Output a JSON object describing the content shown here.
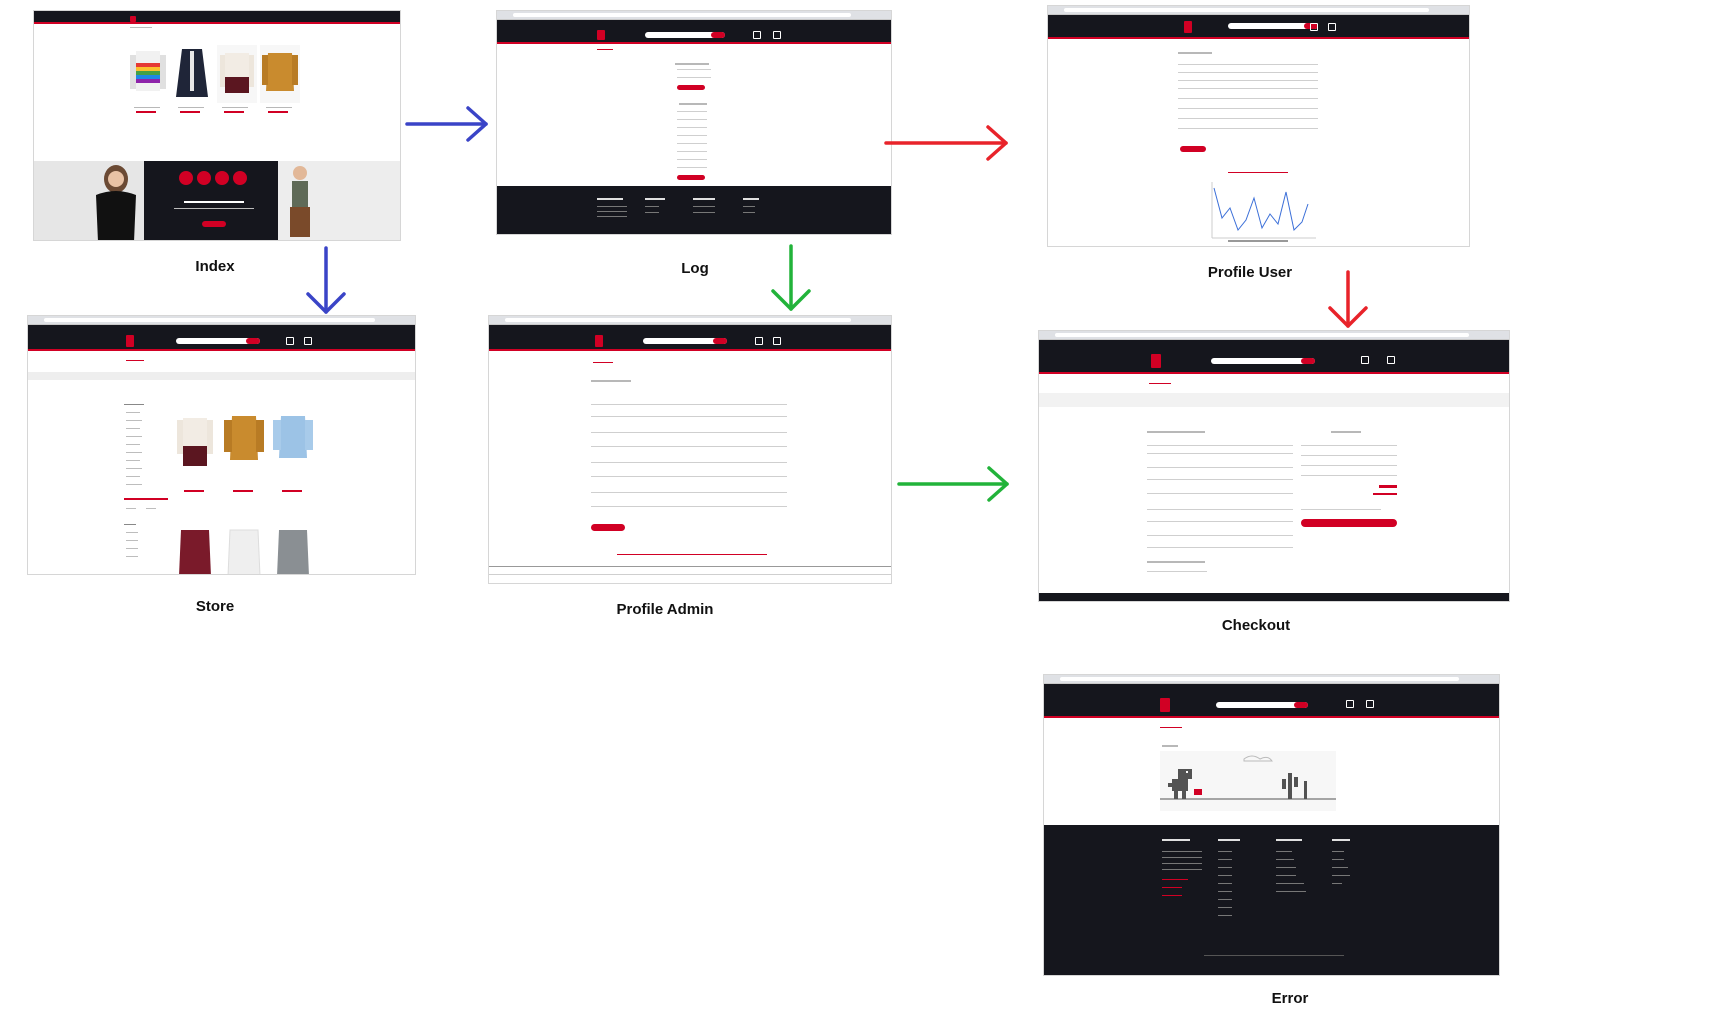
{
  "captions": {
    "index": "Index",
    "log": "Log",
    "profile_user": "Profile User",
    "store": "Store",
    "profile_admin": "Profile Admin",
    "checkout": "Checkout",
    "error": "Error"
  },
  "arrow_colors": {
    "index_to_log": "#3a44c7",
    "index_to_store": "#3a44c7",
    "log_to_profile_user": "#e8232a",
    "profile_user_to_checkout": "#e8232a",
    "log_to_profile_admin": "#22b33a",
    "profile_admin_to_checkout": "#22b33a"
  },
  "theme": {
    "brand_red": "#d10024",
    "dark": "#15161d"
  }
}
